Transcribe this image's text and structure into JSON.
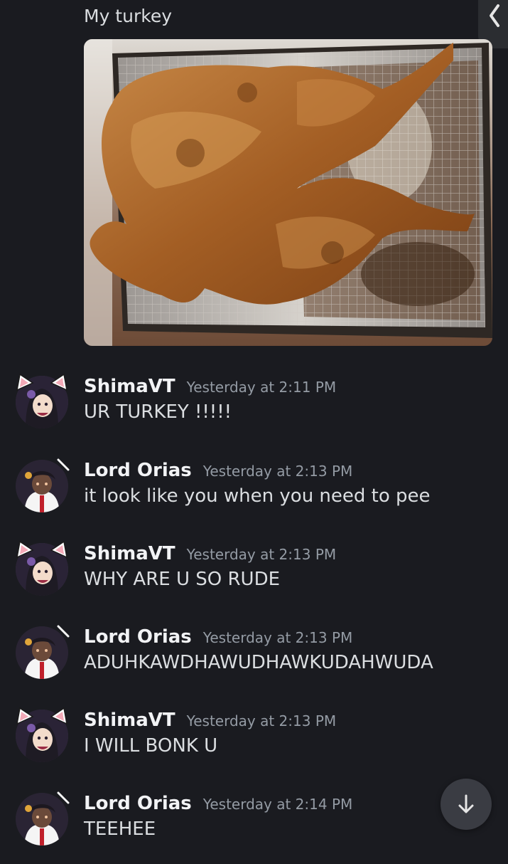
{
  "top": {
    "text": "My turkey"
  },
  "attachment": {
    "alt": "turkey"
  },
  "messages": [
    {
      "user": "ShimaVT",
      "time": "Yesterday at 2:11 PM",
      "text": "UR TURKEY !!!!!"
    },
    {
      "user": "Lord Orias",
      "time": "Yesterday at 2:13 PM",
      "text": "it look like you when you need to pee"
    },
    {
      "user": "ShimaVT",
      "time": "Yesterday at 2:13 PM",
      "text": "WHY ARE U SO RUDE"
    },
    {
      "user": "Lord Orias",
      "time": "Yesterday at 2:13 PM",
      "text": "ADUHKAWDHAWUDHAWKUDAHWUDA"
    },
    {
      "user": "ShimaVT",
      "time": "Yesterday at 2:13 PM",
      "text": "I WILL BONK U"
    },
    {
      "user": "Lord Orias",
      "time": "Yesterday at 2:14 PM",
      "text": "TEEHEE"
    }
  ],
  "colors": {
    "background": "#1a1b20",
    "username": "#f2f3f5",
    "timestamp": "#949ba4",
    "text": "#dbdee1"
  },
  "icons": {
    "back": "chevron-left-icon",
    "scroll": "arrow-down-icon"
  }
}
